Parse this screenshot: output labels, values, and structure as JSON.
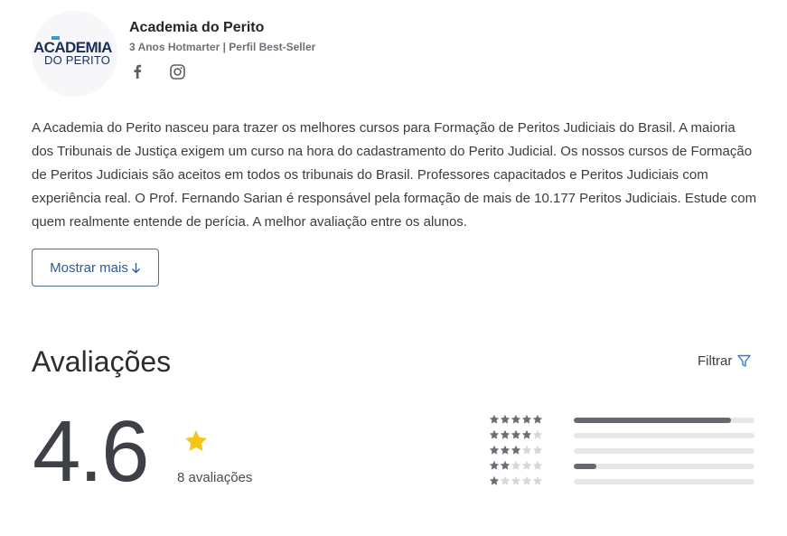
{
  "profile": {
    "logo_main": "ACADEMIA",
    "logo_sub": "DO PERITO",
    "name": "Academia do Perito",
    "subtitle": "3 Anos Hotmarter | Perfil Best-Seller",
    "social": [
      {
        "icon": "facebook-icon"
      },
      {
        "icon": "instagram-icon"
      }
    ]
  },
  "description": "A Academia do Perito nasceu para trazer os melhores cursos para Formação de Peritos Judiciais do Brasil. A maioria dos Tribunais de Justiça exigem um curso na hora do cadastramento do Perito Judicial. Os nossos cursos de Formação de Peritos Judiciais são aceitos em todos os tribunais do Brasil. Professores capacitados e Peritos Judiciais com experiência real. O Prof. Fernando Sarian é responsável pela formação de mais de 10.177 Peritos Judiciais. Estude com quem realmente entende de perícia. A melhor avaliação entre os alunos.",
  "show_more_label": "Mostrar mais",
  "reviews": {
    "title": "Avaliações",
    "filter_label": "Filtrar",
    "score": "4.6",
    "count_label": "8 avaliações",
    "star_color": "#f5c518",
    "distribution": [
      {
        "stars": 5,
        "fraction": 0.87
      },
      {
        "stars": 4,
        "fraction": 0.0
      },
      {
        "stars": 3,
        "fraction": 0.0
      },
      {
        "stars": 2,
        "fraction": 0.125
      },
      {
        "stars": 1,
        "fraction": 0.0
      }
    ]
  }
}
